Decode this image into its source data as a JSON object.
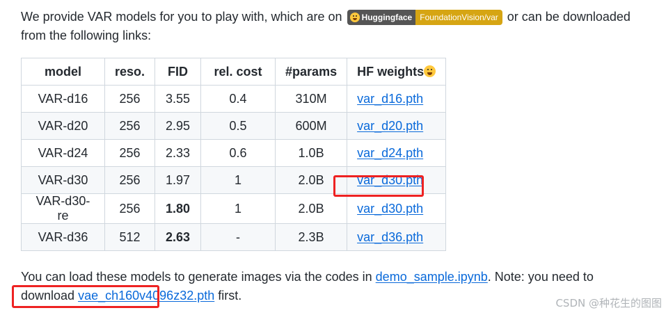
{
  "intro": {
    "before_badge": "We provide VAR models for you to play with, which are on ",
    "badge_left": "Huggingface",
    "badge_right": "FoundationVision/var",
    "after_badge": " or can be downloaded from the following links:"
  },
  "table": {
    "headers": [
      "model",
      "reso.",
      "FID",
      "rel. cost",
      "#params",
      "HF weights"
    ],
    "rows": [
      {
        "model": "VAR-d16",
        "reso": "256",
        "fid": "3.55",
        "cost": "0.4",
        "params": "310M",
        "weights": "var_d16.pth"
      },
      {
        "model": "VAR-d20",
        "reso": "256",
        "fid": "2.95",
        "cost": "0.5",
        "params": "600M",
        "weights": "var_d20.pth"
      },
      {
        "model": "VAR-d24",
        "reso": "256",
        "fid": "2.33",
        "cost": "0.6",
        "params": "1.0B",
        "weights": "var_d24.pth"
      },
      {
        "model": "VAR-d30",
        "reso": "256",
        "fid": "1.97",
        "cost": "1",
        "params": "2.0B",
        "weights": "var_d30.pth"
      },
      {
        "model": "VAR-d30-re",
        "reso": "256",
        "fid": "1.80",
        "cost": "1",
        "params": "2.0B",
        "weights": "var_d30.pth"
      },
      {
        "model": "VAR-d36",
        "reso": "512",
        "fid": "2.63",
        "cost": "-",
        "params": "2.3B",
        "weights": "var_d36.pth"
      }
    ]
  },
  "footer": {
    "text1": "You can load these models to generate images via the codes in ",
    "link1": "demo_sample.ipynb",
    "text2": ". Note: you need to download ",
    "link2": "vae_ch160v4096z32.pth",
    "text3": " first."
  },
  "watermark": "CSDN @种花生的图图",
  "colors": {
    "link": "#0969da",
    "highlight": "#ee2222",
    "badge_left": "#555555",
    "badge_right": "#d6a513"
  }
}
